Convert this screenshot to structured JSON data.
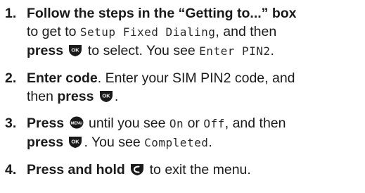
{
  "steps": [
    {
      "number": "1.",
      "line1_bold": "Follow the steps in the “Getting to...” box",
      "line2_prefix": "to get to ",
      "line2_lcd": "Setup Fixed Dialing",
      "line2_suffix": ", and then",
      "line3_press": "press",
      "line3_mid": " to select. You see ",
      "line3_lcd": "Enter PIN2",
      "line3_end": "."
    },
    {
      "number": "2.",
      "line1_bold": "Enter code",
      "line1_rest": ". Enter your SIM PIN2 code, and",
      "line2_prefix": "then ",
      "line2_press": "press",
      "line2_end": "."
    },
    {
      "number": "3.",
      "line1_bold": "Press",
      "line1_mid": " until you see ",
      "line1_lcd_on": "On",
      "line1_or": " or ",
      "line1_lcd_off": "Off",
      "line1_end": ", and then",
      "line2_press": "press",
      "line2_mid": ". You see ",
      "line2_lcd": "Completed",
      "line2_end": "."
    },
    {
      "number": "4.",
      "line1_bold": "Press and hold",
      "line1_rest": " to exit the menu."
    }
  ],
  "icons": {
    "ok": "ok-key-icon",
    "menu": "menu-key-icon",
    "end": "end-key-icon"
  },
  "icon_labels": {
    "ok": "OK",
    "menu": "MENU"
  },
  "colors": {
    "text": "#1a1a1a",
    "key_fill": "#1a1a1a",
    "key_text": "#ffffff"
  }
}
